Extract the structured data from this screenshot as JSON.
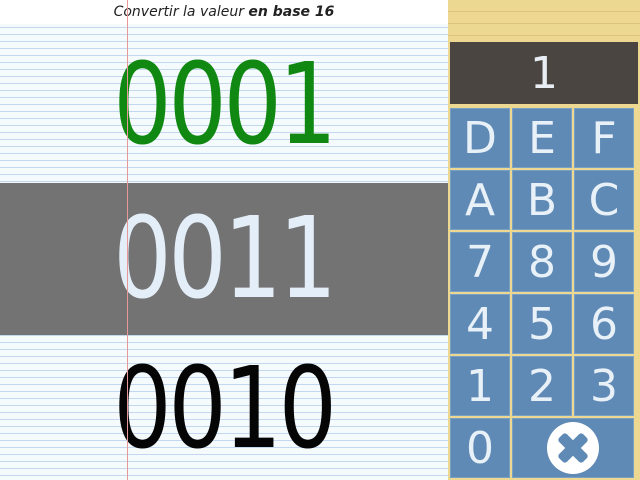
{
  "instruction": {
    "prefix": "Convertir la valeur ",
    "emphasis": "en base 16"
  },
  "rows": {
    "top": "0001",
    "middle": "0011",
    "bottom": "0010"
  },
  "colors": {
    "top_row_text": "#118811",
    "middle_row_band": "#737373",
    "middle_row_text": "#e4eef9",
    "bottom_row_text": "#050505",
    "key_background": "#5f8ab5",
    "panel_background": "#ecd890",
    "display_background": "#4a4540"
  },
  "display": {
    "value": "1"
  },
  "keypad": {
    "keys": [
      "D",
      "E",
      "F",
      "A",
      "B",
      "C",
      "7",
      "8",
      "9",
      "4",
      "5",
      "6",
      "1",
      "2",
      "3",
      "0"
    ],
    "clear_icon": "clear-icon"
  }
}
